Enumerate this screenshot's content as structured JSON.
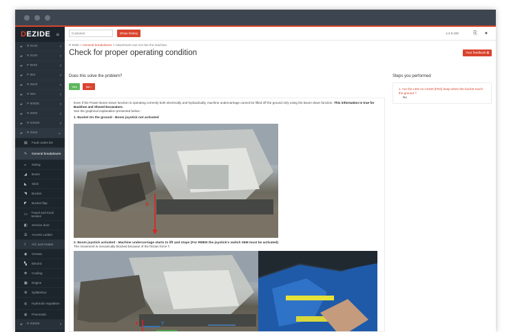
{
  "sidebar": {
    "logo_rest": "EZIDE",
    "logo_first": "D",
    "items": [
      {
        "label": "R 9100"
      },
      {
        "label": "R 9150"
      },
      {
        "label": "P 9640"
      },
      {
        "label": "P 964"
      },
      {
        "label": "R 9640"
      },
      {
        "label": "R 984"
      },
      {
        "label": "P 9050E"
      },
      {
        "label": "R 9050"
      },
      {
        "label": "R 9250E"
      },
      {
        "label": "R 9250"
      }
    ],
    "sub_items": [
      {
        "label": "Fault codes list",
        "icon": "doc-icon"
      },
      {
        "label": "General breakdowns",
        "icon": "wrench-icon",
        "active": true
      },
      {
        "label": "Swing",
        "icon": "swing-icon"
      },
      {
        "label": "Boom",
        "icon": "boom-icon"
      },
      {
        "label": "Stick",
        "icon": "stick-icon"
      },
      {
        "label": "Bucket",
        "icon": "bucket-icon"
      },
      {
        "label": "Bucket flap",
        "icon": "flap-icon"
      },
      {
        "label": "Travel and track tension",
        "icon": "track-icon"
      },
      {
        "label": "Service door",
        "icon": "door-icon"
      },
      {
        "label": "Access Ladder",
        "icon": "ladder-icon"
      },
      {
        "label": "A/C and Heater",
        "icon": "hvac-icon"
      },
      {
        "label": "Grease",
        "icon": "grease-icon"
      },
      {
        "label": "Electric",
        "icon": "electric-icon"
      },
      {
        "label": "Cooling",
        "icon": "cooling-icon"
      },
      {
        "label": "Engine",
        "icon": "engine-icon"
      },
      {
        "label": "Splitterbox",
        "icon": "splitter-icon"
      },
      {
        "label": "Hydraulic regulation",
        "icon": "hydraulic-icon"
      },
      {
        "label": "Pneumatic",
        "icon": "pneumatic-icon"
      }
    ],
    "last_item": {
      "label": "R 9350E"
    }
  },
  "topbar": {
    "search_placeholder": "Customer",
    "show_history": "Show history",
    "version": "4.2.0.180"
  },
  "breadcrumb": {
    "root": "R 9250",
    "sep1": ">",
    "link": "General breakdowns",
    "sep2": ">",
    "current": "Attachment can not rise the machine"
  },
  "page_title": "Check for proper operating condition",
  "feedback_button": "Your feedback",
  "question": "Does this solve the problem?",
  "yes_label": "Yes",
  "no_label": "No",
  "body": {
    "intro": "Even if the Power Boom Down function is operating correctly both electrically and hydraulically, machine undercarriage cannot be lifted off the ground only using the Boom down function.",
    "intro_bold": "This information is true for Backhoe and Shovel Excavators.",
    "see": "See the graphical explanation presented below :",
    "step1": "1. Bucket On the ground - Boom joystick not activated",
    "step2": "2. Boom joystick activated - Machine undercarriage starts to lift and stops (For R9800 the joystick's switch S6M must be activated)",
    "step2_sub": "The movement is mecanically blocked because of the friction force T.",
    "img_labels": {
      "f": "F",
      "t": "T"
    }
  },
  "steps_panel": {
    "heading": "Steps you performed",
    "steps": [
      {
        "question": "1. Are the LED on A1020 [F5G] beep when the bucket touch the ground ?",
        "answer": "No"
      }
    ]
  },
  "colors": {
    "accent": "#d9442e",
    "success": "#5cb85c",
    "sidebar": "#222b33"
  }
}
